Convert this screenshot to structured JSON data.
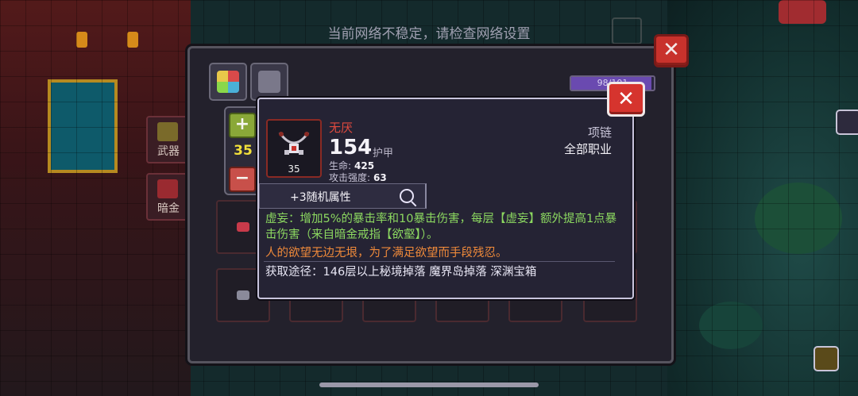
{
  "network_warning": "当前网络不稳定，请检查网络设置",
  "side_tabs": [
    {
      "label": "武器"
    },
    {
      "label": "暗金"
    }
  ],
  "inventory": {
    "capacity_text": "98/101",
    "capacity_fraction": 0.97,
    "stepper_value": "35",
    "plus_symbol": "+",
    "minus_symbol": "−"
  },
  "close_symbol": "✕",
  "item": {
    "name": "无厌",
    "armor_value": "154",
    "armor_label": "护甲",
    "stats": [
      {
        "label": "生命:",
        "value": "425"
      },
      {
        "label": "攻击强度:",
        "value": "63"
      }
    ],
    "level": "35",
    "type": "项链",
    "class": "全部职业",
    "random_attr": "+3随机属性",
    "effect": "虚妄：增加5%的暴击率和10暴击伤害，每层【虚妄】额外提高1点暴击伤害（来自暗金戒指【欲壑】）。",
    "flavor": "人的欲望无边无垠，为了满足欲望而手段残忍。",
    "source": "获取途径：146层以上秘境掉落 魔界岛掉落 深渊宝箱",
    "name_color": "#e04a3e",
    "effect_color": "#8cd860",
    "flavor_color": "#f08a3a"
  }
}
